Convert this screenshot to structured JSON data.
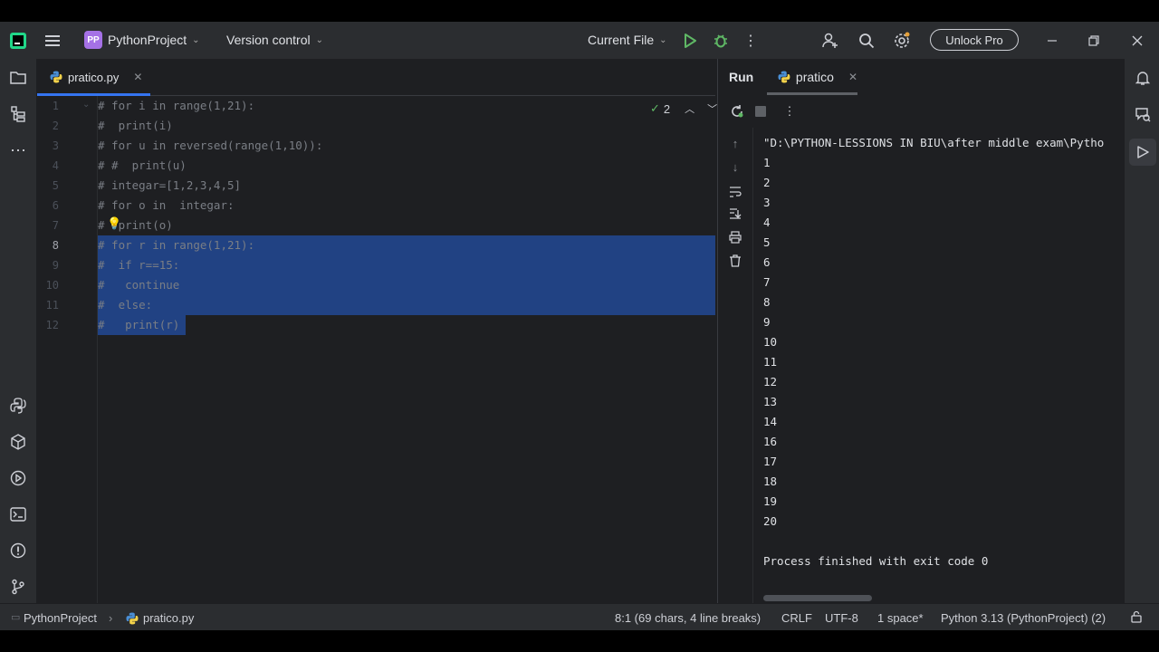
{
  "titlebar": {
    "project_badge": "PP",
    "project_name": "PythonProject",
    "vcs": "Version control",
    "run_config": "Current File",
    "unlock_label": "Unlock Pro"
  },
  "editor": {
    "tab_label": "pratico.py",
    "inspection_count": "2",
    "lines": [
      {
        "num": "1",
        "text": "# for i in range(1,21):"
      },
      {
        "num": "2",
        "text": "#  print(i)"
      },
      {
        "num": "3",
        "text": "# for u in reversed(range(1,10)):"
      },
      {
        "num": "4",
        "text": "# #  print(u)"
      },
      {
        "num": "5",
        "text": "# integar=[1,2,3,4,5]"
      },
      {
        "num": "6",
        "text": "# for o in  integar:"
      },
      {
        "num": "7",
        "text": "#  print(o)"
      },
      {
        "num": "8",
        "text": "# for r in range(1,21):"
      },
      {
        "num": "9",
        "text": "#  if r==15:"
      },
      {
        "num": "10",
        "text": "#   continue"
      },
      {
        "num": "11",
        "text": "#  else:"
      },
      {
        "num": "12",
        "text": "#   print(r)"
      }
    ]
  },
  "run": {
    "title": "Run",
    "tab_label": "pratico",
    "command": "\"D:\\PYTHON-LESSIONS IN BIU\\after middle exam\\Pytho",
    "output": [
      "1",
      "2",
      "3",
      "4",
      "5",
      "6",
      "7",
      "8",
      "9",
      "10",
      "11",
      "12",
      "13",
      "14",
      "16",
      "17",
      "18",
      "19",
      "20"
    ],
    "exit_message": "Process finished with exit code 0"
  },
  "statusbar": {
    "project": "PythonProject",
    "file": "pratico.py",
    "position": "8:1 (69 chars, 4 line breaks)",
    "line_sep": "CRLF",
    "encoding": "UTF-8",
    "indent": "1 space*",
    "interpreter": "Python 3.13 (PythonProject) (2)"
  },
  "colors": {
    "selection": "#214283",
    "accent": "#3574f0",
    "run_green": "#5fb865"
  }
}
